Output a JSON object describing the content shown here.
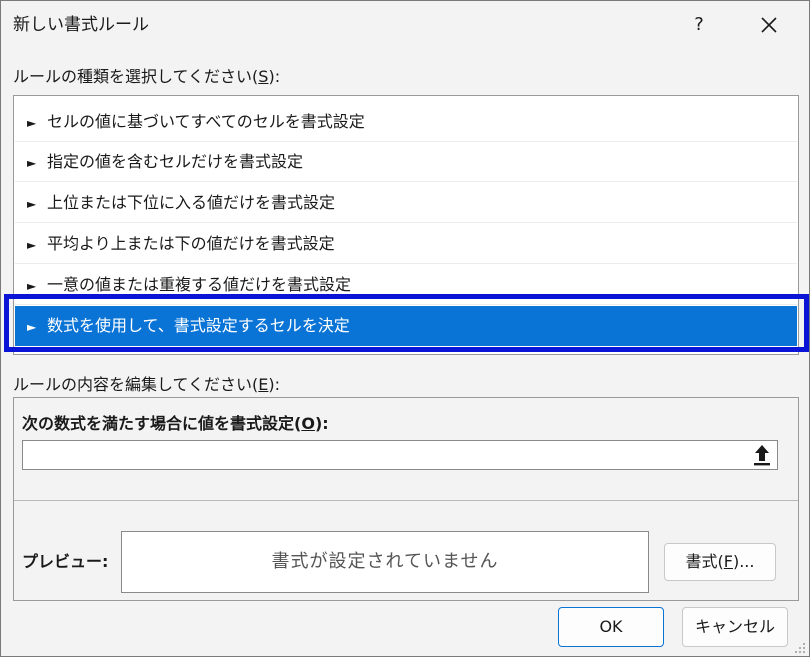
{
  "window": {
    "title": "新しい書式ルール",
    "help_label": "?"
  },
  "rule_type": {
    "label_text": "ルールの種類を選択してください(",
    "label_key": "S",
    "label_end": "):",
    "items": [
      {
        "label": "セルの値に基づいてすべてのセルを書式設定"
      },
      {
        "label": "指定の値を含むセルだけを書式設定"
      },
      {
        "label": "上位または下位に入る値だけを書式設定"
      },
      {
        "label": "平均より上または下の値だけを書式設定"
      },
      {
        "label": "一意の値または重複する値だけを書式設定"
      },
      {
        "label": "数式を使用して、書式設定するセルを決定"
      }
    ],
    "selected_index": 5
  },
  "edit_rule": {
    "label_text": "ルールの内容を編集してください(",
    "label_key": "E",
    "label_end": "):",
    "formula_label_text": "次の数式を満たす場合に値を書式設定(",
    "formula_label_key": "O",
    "formula_label_end": "):",
    "formula_value": "",
    "preview_label": "プレビュー:",
    "preview_text": "書式が設定されていません",
    "format_button_text": "書式(",
    "format_button_key": "F",
    "format_button_end": ")..."
  },
  "buttons": {
    "ok": "OK",
    "cancel": "キャンセル"
  },
  "colors": {
    "selection": "#0a74d6",
    "highlight_box": "#0a14d6"
  }
}
